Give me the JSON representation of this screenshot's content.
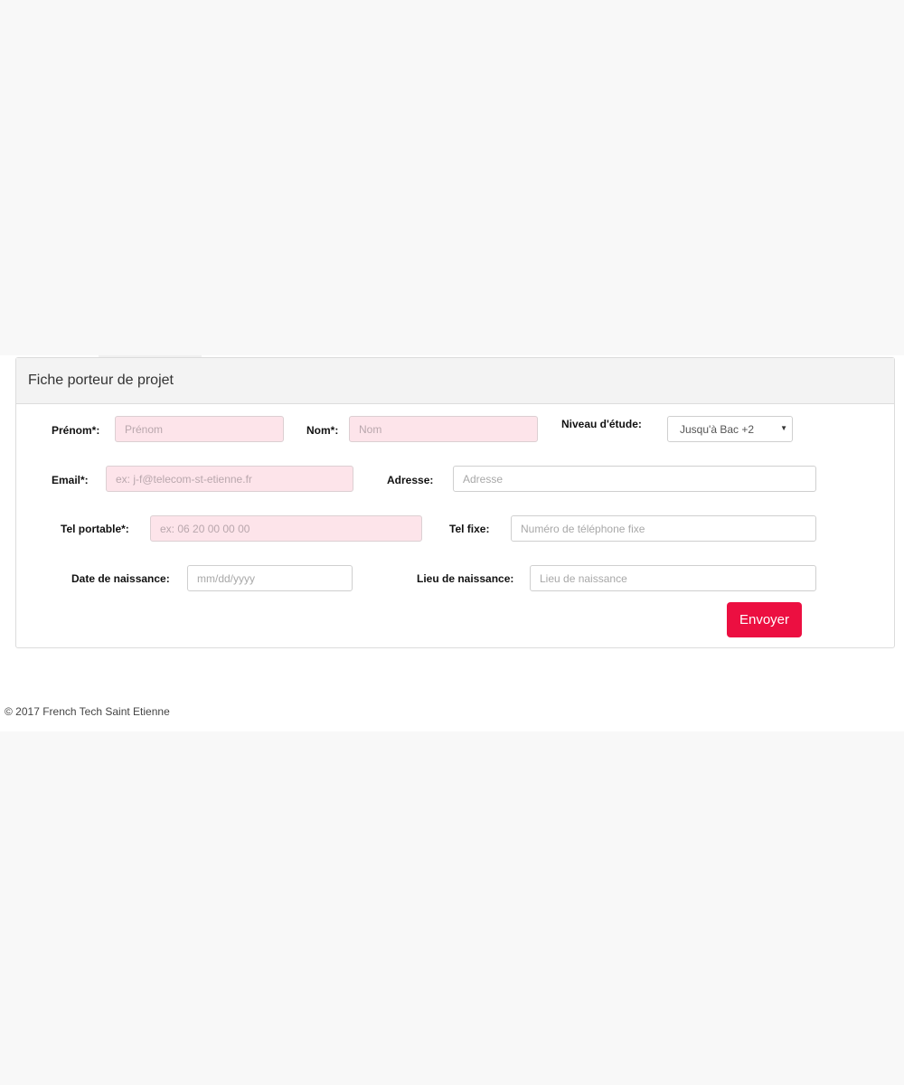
{
  "panel": {
    "title": "Fiche porteur de projet"
  },
  "form": {
    "prenom": {
      "label": "Prénom*:",
      "placeholder": "Prénom"
    },
    "nom": {
      "label": "Nom*:",
      "placeholder": "Nom"
    },
    "niveau": {
      "label": "Niveau d'étude:",
      "selected": "Jusqu'à Bac +2"
    },
    "email": {
      "label": "Email*:",
      "placeholder": "ex: j-f@telecom-st-etienne.fr"
    },
    "adresse": {
      "label": "Adresse:",
      "placeholder": "Adresse"
    },
    "tel_portable": {
      "label": "Tel portable*:",
      "placeholder": "ex: 06 20 00 00 00"
    },
    "tel_fixe": {
      "label": "Tel fixe:",
      "placeholder": "Numéro de téléphone fixe"
    },
    "date_naissance": {
      "label": "Date de naissance:",
      "placeholder": "mm/dd/yyyy"
    },
    "lieu_naissance": {
      "label": "Lieu de naissance:",
      "placeholder": "Lieu de naissance"
    },
    "submit_label": "Envoyer"
  },
  "footer": {
    "text": "© 2017 French Tech Saint Etienne"
  },
  "colors": {
    "accent": "#ec0f41",
    "required_field_bg": "#fde4ea",
    "page_bg": "#f8f8f8"
  },
  "icons": {
    "select_caret": "caret-down-icon"
  }
}
